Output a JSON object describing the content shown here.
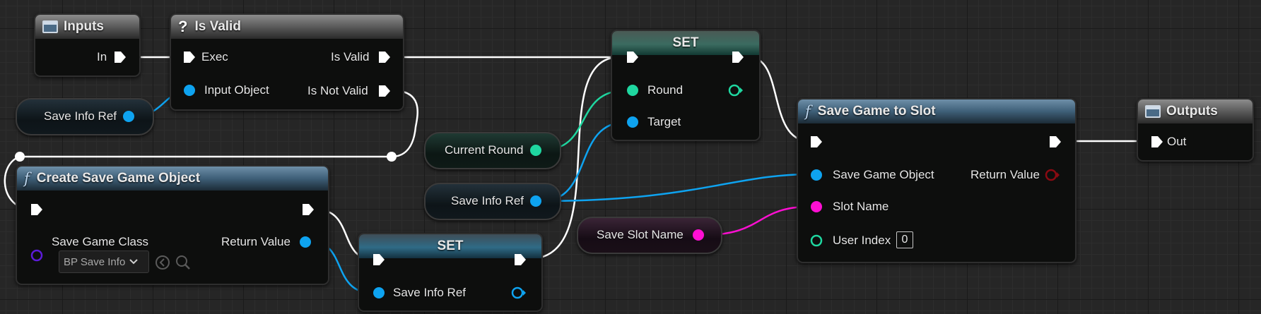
{
  "colors": {
    "exec": "#ffffff",
    "object_ref": "#0ea3f0",
    "integer": "#1fd7a0",
    "string": "#ff0fd3",
    "class": "#5c1bd8",
    "return_value": "#8a0a12"
  },
  "nodes": {
    "inputs": {
      "title": "Inputs",
      "icon": "tunnel-icon",
      "pin_in": "In"
    },
    "is_valid": {
      "title": "Is Valid",
      "icon": "question-icon",
      "pin_exec": "Exec",
      "pin_input_object": "Input Object",
      "pin_is_valid": "Is Valid",
      "pin_is_not_valid": "Is Not Valid"
    },
    "set_round": {
      "title": "SET",
      "pin_round": "Round",
      "pin_target": "Target"
    },
    "save_game_to_slot": {
      "title": "Save Game to Slot",
      "icon": "function-icon",
      "pin_save_game_object": "Save Game Object",
      "pin_slot_name": "Slot Name",
      "pin_user_index": "User Index",
      "user_index_value": "0",
      "pin_return_value": "Return Value"
    },
    "outputs": {
      "title": "Outputs",
      "icon": "tunnel-icon",
      "pin_out": "Out"
    },
    "create_save_game_object": {
      "title": "Create Save Game Object",
      "icon": "function-icon",
      "pin_save_game_class": "Save Game Class",
      "class_value": "BP Save Info",
      "pin_return_value": "Return Value"
    },
    "set_save_info_ref": {
      "title": "SET",
      "pin_save_info_ref": "Save Info Ref"
    }
  },
  "variables": {
    "save_info_ref_1": "Save Info Ref",
    "current_round": "Current Round",
    "save_info_ref_2": "Save Info Ref",
    "save_slot_name": "Save Slot Name"
  }
}
